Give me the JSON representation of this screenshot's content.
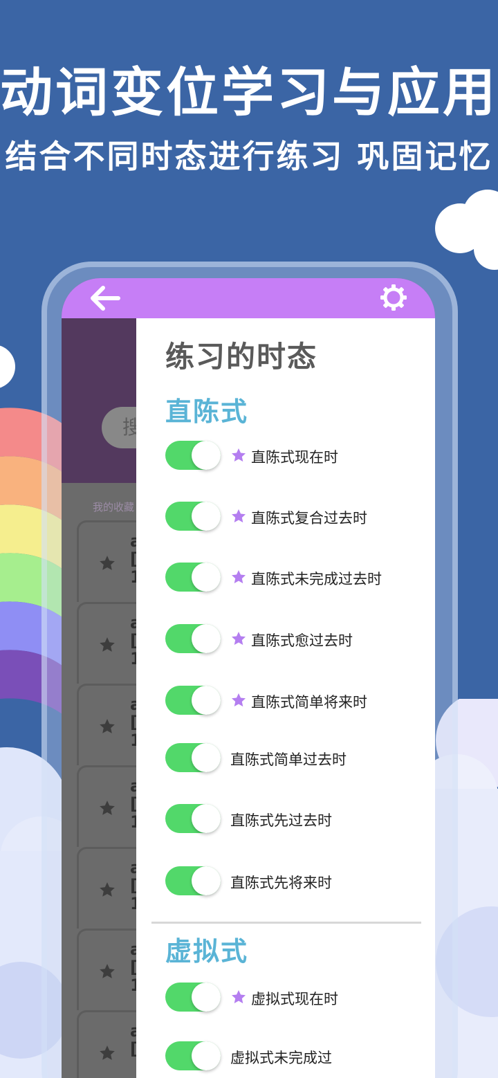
{
  "promo": {
    "headline": "动词变位学习与应用",
    "subline": "结合不同时态进行练习 巩固记忆"
  },
  "background_screen": {
    "search_placeholder": "搜",
    "favorites_label": "我的收藏",
    "rows": [
      {
        "letter": "a",
        "line2": "[a",
        "line3": "1"
      },
      {
        "letter": "a",
        "line2": "[a",
        "line3": "1"
      },
      {
        "letter": "a",
        "line2": "[a",
        "line3": "1"
      },
      {
        "letter": "a",
        "line2": "[a",
        "line3": "1"
      },
      {
        "letter": "a",
        "line2": "[a",
        "line3": "1"
      },
      {
        "letter": "a",
        "line2": "[a",
        "line3": "1"
      },
      {
        "letter": "a",
        "line2": "[a",
        "line3": ""
      }
    ]
  },
  "drawer": {
    "title": "练习的时态",
    "sections": [
      {
        "title": "直陈式",
        "items": [
          {
            "label": "直陈式现在时",
            "starred": true,
            "enabled": true
          },
          {
            "label": "直陈式复合过去时",
            "starred": true,
            "enabled": true
          },
          {
            "label": "直陈式未完成过去时",
            "starred": true,
            "enabled": true
          },
          {
            "label": "直陈式愈过去时",
            "starred": true,
            "enabled": true
          },
          {
            "label": "直陈式简单将来时",
            "starred": true,
            "enabled": true
          },
          {
            "label": "直陈式简单过去时",
            "starred": false,
            "enabled": true
          },
          {
            "label": "直陈式先过去时",
            "starred": false,
            "enabled": true
          },
          {
            "label": "直陈式先将来时",
            "starred": false,
            "enabled": true
          }
        ]
      },
      {
        "title": "虚拟式",
        "items": [
          {
            "label": "虚拟式现在时",
            "starred": true,
            "enabled": true
          },
          {
            "label": "虚拟式未完成过",
            "starred": false,
            "enabled": true
          }
        ]
      }
    ]
  },
  "colors": {
    "background": "#3b65a5",
    "app_bar": "#c67ef6",
    "switch_on": "#52d86a",
    "section_title": "#5ab4d6",
    "star": "#b47ef0"
  },
  "icons": {
    "back": "back-arrow-icon",
    "settings": "gear-icon",
    "star": "star-icon"
  }
}
